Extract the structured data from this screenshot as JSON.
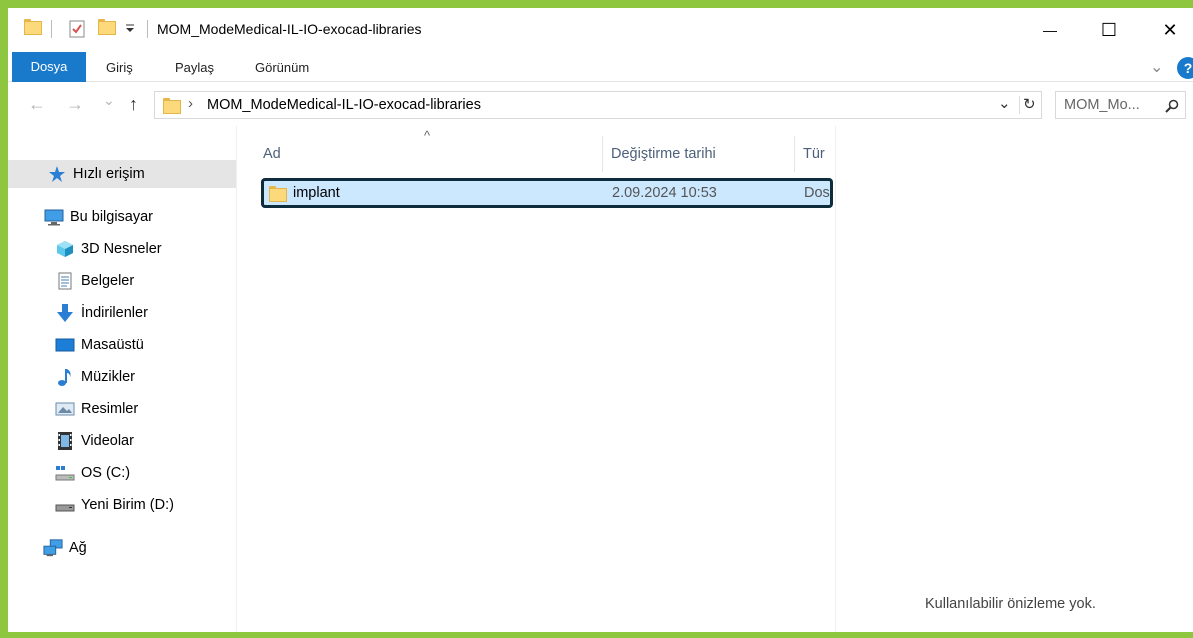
{
  "window": {
    "title": "MOM_ModeMedical-IL-IO-exocad-libraries",
    "minimize": "—",
    "maximize": "☐",
    "close": "✕"
  },
  "ribbon": {
    "tabs": [
      {
        "label": "Dosya"
      },
      {
        "label": "Giriş"
      },
      {
        "label": "Paylaş"
      },
      {
        "label": "Görünüm"
      }
    ],
    "expand": "⌄",
    "help": "?"
  },
  "nav": {
    "back": "←",
    "forward": "→",
    "recent": "⌄",
    "up": "↑",
    "breadcrumb_sep": "›",
    "path": "MOM_ModeMedical-IL-IO-exocad-libraries",
    "dropdown": "⌄",
    "refresh": "↻",
    "search_placeholder": "MOM_Mo...",
    "search_icon": "search-icon"
  },
  "sidebar": {
    "items": [
      {
        "label": "Hızlı erişim",
        "icon": "star-icon"
      },
      {
        "label": "Bu bilgisayar",
        "icon": "computer-icon"
      },
      {
        "label": "3D Nesneler",
        "icon": "cube-icon"
      },
      {
        "label": "Belgeler",
        "icon": "document-icon"
      },
      {
        "label": "İndirilenler",
        "icon": "download-icon"
      },
      {
        "label": "Masaüstü",
        "icon": "desktop-icon"
      },
      {
        "label": "Müzikler",
        "icon": "music-icon"
      },
      {
        "label": "Resimler",
        "icon": "pictures-icon"
      },
      {
        "label": "Videolar",
        "icon": "video-icon"
      },
      {
        "label": "OS (C:)",
        "icon": "drive-c-icon"
      },
      {
        "label": "Yeni Birim (D:)",
        "icon": "drive-d-icon"
      },
      {
        "label": "Ağ",
        "icon": "network-icon"
      }
    ]
  },
  "list": {
    "sort_indicator": "^",
    "columns": [
      {
        "label": "Ad"
      },
      {
        "label": "Değiştirme tarihi"
      },
      {
        "label": "Tür"
      }
    ],
    "rows": [
      {
        "name": "implant",
        "modified": "2.09.2024 10:53",
        "type": "Dos"
      }
    ]
  },
  "preview": {
    "message": "Kullanılabilir önizleme yok."
  },
  "colors": {
    "accent": "#1979ca",
    "selection": "#cce8ff",
    "frame": "#8ec63f"
  }
}
